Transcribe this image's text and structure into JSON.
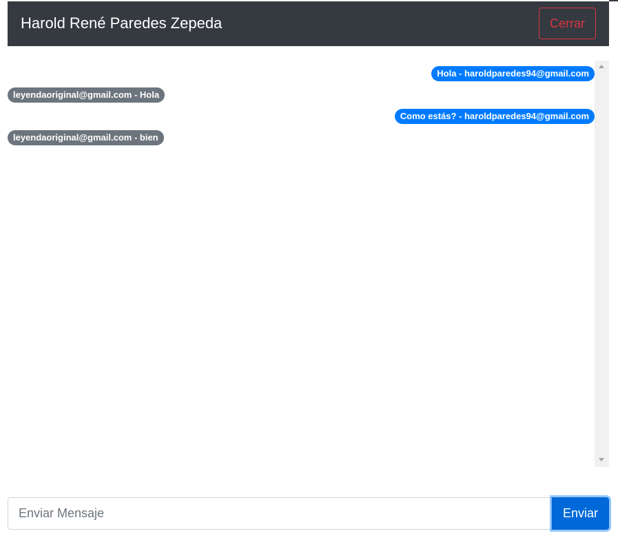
{
  "header": {
    "title": "Harold René Paredes Zepeda",
    "close_label": "Cerrar"
  },
  "chat": {
    "messages": [
      {
        "text": "Hola - haroldparedes94@gmail.com",
        "side": "right",
        "color": "#007bff"
      },
      {
        "text": "leyendaoriginal@gmail.com - Hola",
        "side": "left",
        "color": "#6c757d"
      },
      {
        "text": "Como estás? - haroldparedes94@gmail.com",
        "side": "right",
        "color": "#007bff"
      },
      {
        "text": "leyendaoriginal@gmail.com - bien",
        "side": "left",
        "color": "#6c757d"
      }
    ]
  },
  "composer": {
    "placeholder": "Enviar Mensaje",
    "value": "",
    "send_label": "Enviar"
  },
  "colors": {
    "navbar": "#343a40",
    "danger": "#dc3545",
    "primary": "#007bff",
    "secondary": "#6c757d"
  }
}
